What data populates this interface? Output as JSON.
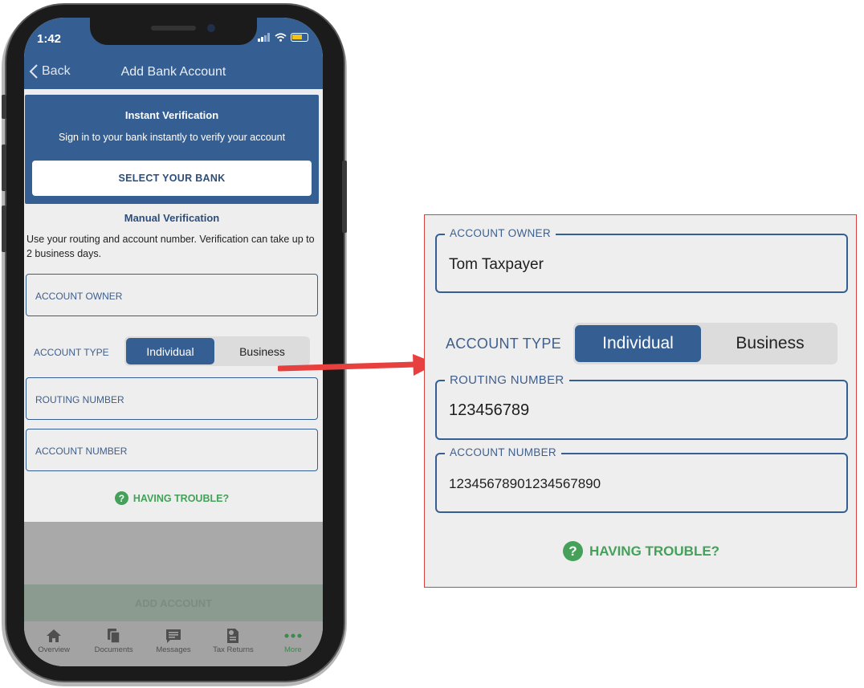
{
  "status_bar": {
    "time": "1:42"
  },
  "nav": {
    "back_label": "Back",
    "title": "Add Bank Account"
  },
  "instant": {
    "title": "Instant Verification",
    "subtitle": "Sign in to your bank instantly to verify your account",
    "button_label": "SELECT YOUR BANK"
  },
  "manual": {
    "title": "Manual Verification",
    "description": "Use your routing and account number. Verification can take up to 2 business days."
  },
  "form": {
    "account_owner_label": "ACCOUNT OWNER",
    "account_type_label": "ACCOUNT TYPE",
    "account_type_options": [
      "Individual",
      "Business"
    ],
    "account_type_selected": "Individual",
    "routing_number_label": "ROUTING NUMBER",
    "account_number_label": "ACCOUNT NUMBER"
  },
  "help": {
    "having_trouble": "HAVING TROUBLE?"
  },
  "footer": {
    "add_account_label": "ADD ACCOUNT"
  },
  "tabs": [
    {
      "label": "Overview",
      "icon": "home-icon"
    },
    {
      "label": "Documents",
      "icon": "documents-icon"
    },
    {
      "label": "Messages",
      "icon": "messages-icon"
    },
    {
      "label": "Tax Returns",
      "icon": "tax-returns-icon"
    },
    {
      "label": "More",
      "icon": "more-icon",
      "active": true
    }
  ],
  "zoom": {
    "account_owner_label": "ACCOUNT OWNER",
    "account_owner_value": "Tom Taxpayer",
    "account_type_label": "ACCOUNT TYPE",
    "account_type_options": [
      "Individual",
      "Business"
    ],
    "routing_number_label": "ROUTING NUMBER",
    "routing_number_value": "123456789",
    "account_number_label": "ACCOUNT NUMBER",
    "account_number_value": "12345678901234567890",
    "having_trouble": "HAVING TROUBLE?"
  },
  "colors": {
    "primary": "#355f93",
    "success": "#45a05a",
    "callout_border": "#d9413f",
    "arrow": "#e8403f"
  }
}
